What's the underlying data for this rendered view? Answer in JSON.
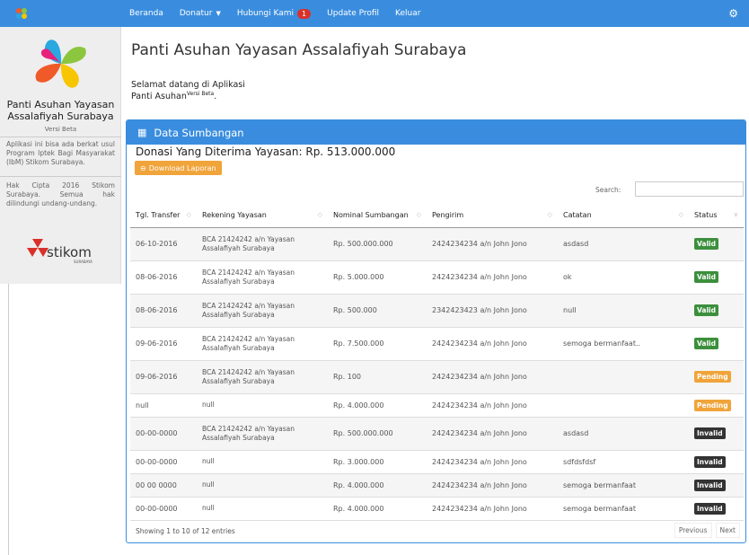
{
  "nav": {
    "items": [
      {
        "label": "Beranda"
      },
      {
        "label": "Donatur"
      },
      {
        "label": "Hubungi Kami",
        "badge": "1"
      },
      {
        "label": "Update Profil"
      },
      {
        "label": "Keluar"
      }
    ]
  },
  "sidebar": {
    "title": "Panti Asuhan Yayasan Assalafiyah Surabaya",
    "version": "Versi Beta",
    "desc1": "Aplikasi ini bisa ada berkat usul Program Iptek Bagi Masyarakat (IbM) Stikom Surabaya.",
    "desc2": "Hak Cipta 2016 Stikom Surabaya. Semua hak dilindungi undang-undang.",
    "logo_text": "stikom",
    "logo_sub": "SURABAYA"
  },
  "main": {
    "title": "Panti Asuhan Yayasan Assalafiyah Surabaya",
    "welcome_line1": "Selamat datang di Aplikasi",
    "welcome_line2": "Panti Asuhan",
    "welcome_sup": "Versi Beta",
    "welcome_end": "."
  },
  "panel": {
    "heading": "Data Sumbangan",
    "donasi": "Donasi Yang Diterima Yayasan: Rp. 513.000.000",
    "download_label": "Download Laporan",
    "search_label": "Search:",
    "search_value": "",
    "columns": [
      "Tgl. Transfer",
      "Rekening Yayasan",
      "Nominal Sumbangan",
      "Pengirim",
      "Catatan",
      "Status"
    ],
    "rows": [
      {
        "tgl": "06-10-2016",
        "rek": "BCA 21424242 a/n Yayasan Assalafiyah Surabaya",
        "nominal": "Rp. 500.000.000",
        "pengirim": "2424234234 a/n John Jono",
        "catatan": "asdasd",
        "status": "Valid",
        "tall": true
      },
      {
        "tgl": "08-06-2016",
        "rek": "BCA 21424242 a/n Yayasan Assalafiyah Surabaya",
        "nominal": "Rp. 5.000.000",
        "pengirim": "2424234234 a/n John Jono",
        "catatan": "ok",
        "status": "Valid",
        "tall": true
      },
      {
        "tgl": "08-06-2016",
        "rek": "BCA 21424242 a/n Yayasan Assalafiyah Surabaya",
        "nominal": "Rp. 500.000",
        "pengirim": "2342423423 a/n John Jono",
        "catatan": "null",
        "status": "Valid",
        "tall": true
      },
      {
        "tgl": "09-06-2016",
        "rek": "BCA 21424242 a/n Yayasan Assalafiyah Surabaya",
        "nominal": "Rp. 7.500.000",
        "pengirim": "2424234234 a/n John Jono",
        "catatan": "semoga bermanfaat..",
        "status": "Valid",
        "tall": true
      },
      {
        "tgl": "09-06-2016",
        "rek": "BCA 21424242 a/n Yayasan Assalafiyah Surabaya",
        "nominal": "Rp. 100",
        "pengirim": "2424234234 a/n John Jono",
        "catatan": "",
        "status": "Pending",
        "tall": true
      },
      {
        "tgl": "null",
        "rek": "null",
        "nominal": "Rp. 4.000.000",
        "pengirim": "2424234234 a/n John Jono",
        "catatan": "",
        "status": "Pending",
        "tall": false
      },
      {
        "tgl": "00-00-0000",
        "rek": "BCA 21424242 a/n Yayasan Assalafiyah Surabaya",
        "nominal": "Rp. 500.000.000",
        "pengirim": "2424234234 a/n John Jono",
        "catatan": "asdasd",
        "status": "Invalid",
        "tall": true
      },
      {
        "tgl": "00-00-0000",
        "rek": "null",
        "nominal": "Rp. 3.000.000",
        "pengirim": "2424234234 a/n John Jono",
        "catatan": "sdfdsfdsf",
        "status": "Invalid",
        "tall": false
      },
      {
        "tgl": "00 00 0000",
        "rek": "null",
        "nominal": "Rp. 4.000.000",
        "pengirim": "2424234234 a/n John Jono",
        "catatan": "semoga bermanfaat",
        "status": "Invalid",
        "tall": false
      },
      {
        "tgl": "00-00-0000",
        "rek": "null",
        "nominal": "Rp. 4.000.000",
        "pengirim": "2424234234 a/n John Jono",
        "catatan": "semoga bermanfaat",
        "status": "Invalid",
        "tall": false
      }
    ],
    "footer_info": "Showing 1 to 10 of 12 entries",
    "prev_label": "Previous",
    "next_label": "Next"
  },
  "colors": {
    "primary": "#3a8dde",
    "valid": "#3c8f3c",
    "pending": "#f0a43a",
    "invalid": "#333333",
    "badge": "#d9312a"
  }
}
